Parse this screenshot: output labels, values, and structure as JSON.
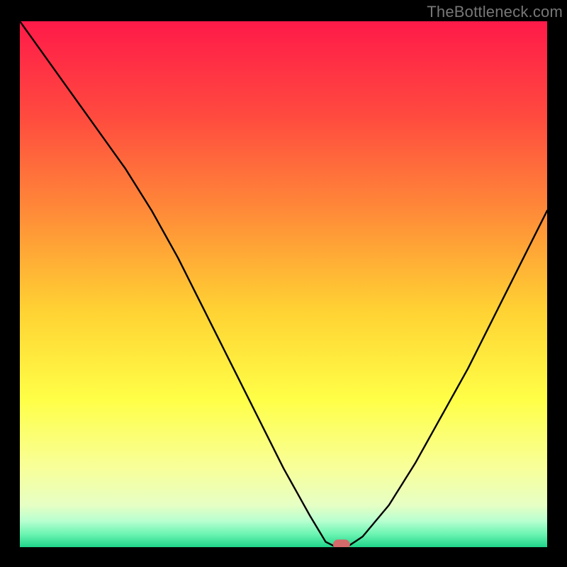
{
  "attribution": "TheBottleneck.com",
  "chart_data": {
    "type": "line",
    "title": "",
    "xlabel": "",
    "ylabel": "",
    "xlim": [
      0,
      100
    ],
    "ylim": [
      0,
      100
    ],
    "x": [
      0,
      5,
      10,
      15,
      20,
      25,
      30,
      35,
      40,
      45,
      50,
      55,
      58,
      60,
      62,
      65,
      70,
      75,
      80,
      85,
      90,
      95,
      100
    ],
    "values": [
      100,
      93,
      86,
      79,
      72,
      64,
      55,
      45,
      35,
      25,
      15,
      6,
      1,
      0,
      0,
      2,
      8,
      16,
      25,
      34,
      44,
      54,
      64
    ],
    "marker": {
      "x": 61,
      "y": 0.5
    },
    "gradient_stops": [
      {
        "offset": 0,
        "color": "#ff1a49"
      },
      {
        "offset": 0.18,
        "color": "#ff4a3f"
      },
      {
        "offset": 0.36,
        "color": "#ff8a38"
      },
      {
        "offset": 0.55,
        "color": "#ffd233"
      },
      {
        "offset": 0.72,
        "color": "#ffff47"
      },
      {
        "offset": 0.85,
        "color": "#f8ff9a"
      },
      {
        "offset": 0.92,
        "color": "#e6ffc4"
      },
      {
        "offset": 0.95,
        "color": "#b8ffd0"
      },
      {
        "offset": 0.975,
        "color": "#6cf5b2"
      },
      {
        "offset": 1.0,
        "color": "#1fd48a"
      }
    ]
  }
}
